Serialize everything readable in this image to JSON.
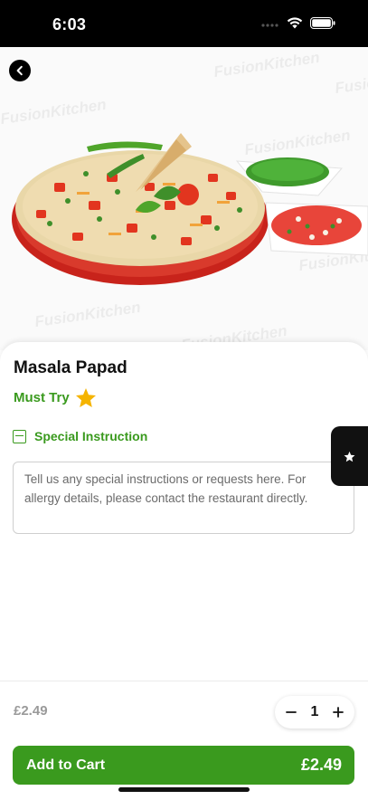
{
  "status_bar": {
    "time": "6:03"
  },
  "hero": {
    "image_alt": "Masala Papad dish",
    "watermark_text": "FusionKitchen"
  },
  "product": {
    "title": "Masala Papad",
    "tag": "Must Try",
    "tag_icon": "star-icon"
  },
  "instructions": {
    "label": "Special Instruction",
    "placeholder": "Tell us any special instructions or requests here. For allergy details, please contact the restaurant directly."
  },
  "footer": {
    "unit_price": "£2.49",
    "quantity": "1",
    "add_to_cart_label": "Add to Cart",
    "total_price": "£2.49"
  },
  "colors": {
    "accent": "#3a9a1e",
    "star": "#f5b400",
    "dark": "#111111"
  }
}
